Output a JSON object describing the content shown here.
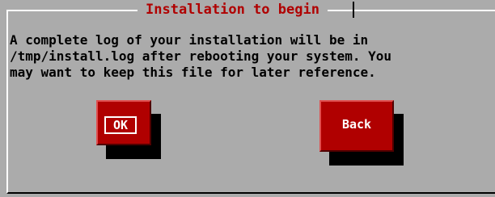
{
  "dialog": {
    "title": "Installation to begin",
    "message": "A complete log of your installation will be in\n/tmp/install.log after rebooting your system. You\nmay want to keep this file for later reference.",
    "buttons": {
      "ok_label": "OK",
      "back_label": "Back"
    }
  },
  "colors": {
    "background": "#ababab",
    "title": "#b00000",
    "button": "#b00000",
    "button_text": "#ffffff",
    "shadow": "#000000"
  }
}
